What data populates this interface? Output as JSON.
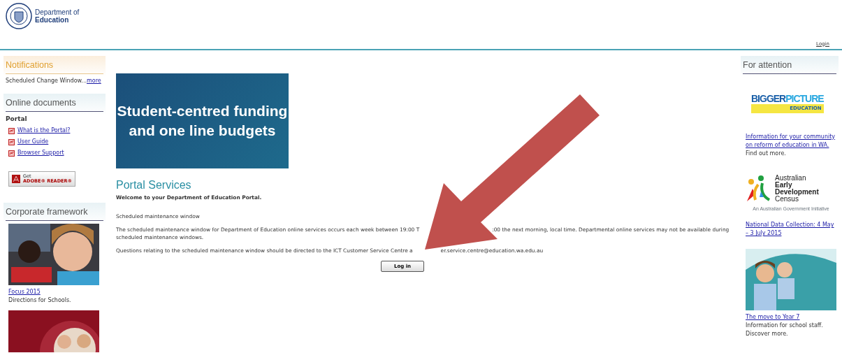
{
  "header": {
    "org_line1": "Department of",
    "org_line2": "Education",
    "login_link": "Login"
  },
  "left_sidebar": {
    "notifications": {
      "title": "Notifications",
      "text": "Scheduled Change Window...",
      "more": "more"
    },
    "online_documents": {
      "title": "Online documents",
      "group": "Portal",
      "links": [
        "What is the Portal?",
        "User Guide",
        "Browser Support"
      ],
      "adobe": {
        "small": "Get",
        "big": "ADOBE® READER®"
      }
    },
    "corporate": {
      "title": "Corporate framework",
      "items": [
        {
          "kind": "picture",
          "link": "Focus 2015",
          "caption": "Directions for Schools."
        },
        {
          "kind": "picture"
        }
      ]
    }
  },
  "main": {
    "banner": "Student-centred funding and one line budgets",
    "title": "Portal Services",
    "welcome": "Welcome to your Department of Education Portal.",
    "paragraphs": [
      {
        "parts": [
          "Scheduled maintenance window"
        ]
      },
      {
        "parts": [
          "The scheduled maintenance window for Department of Education online services occurs each week between 19:00 T",
          ":00 the next morning, local time. Departmental online services may not be available during",
          "scheduled maintenance windows."
        ]
      },
      {
        "parts": [
          "Questions relating to the scheduled maintenance window should be directed to the ICT Customer Service Centre a",
          "er.service.centre@education.wa.edu.au"
        ]
      }
    ],
    "button": "Log in"
  },
  "right_sidebar": {
    "title": "For attention",
    "items": [
      {
        "kind": "bigger",
        "logo_main": "BIGGER",
        "logo_accent": "PICTURE",
        "logo_sub": "EDUCATION",
        "link": "Information for your community on reform of education in WA.",
        "caption": "Find out more."
      },
      {
        "kind": "aedc",
        "logo_lines": [
          "Australian",
          "Early",
          "Development",
          "Census"
        ],
        "logo_sub": "An Australian Government Initiative",
        "link": "National Data Collection: 4 May – 3 July 2015"
      },
      {
        "kind": "picture",
        "link": "The move to Year 7",
        "caption": "Information for school staff. Discover more."
      }
    ]
  }
}
